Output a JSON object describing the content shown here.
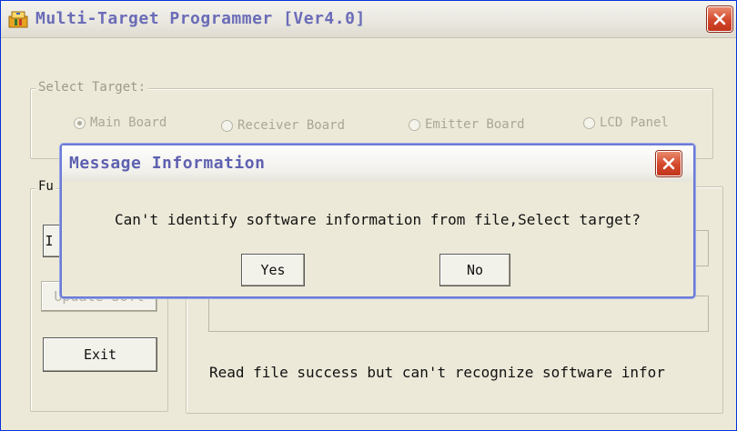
{
  "window": {
    "title": "Multi-Target Programmer [Ver4.0]"
  },
  "select_target": {
    "legend": "Select Target:",
    "options": [
      {
        "label": "Main Board",
        "checked": true
      },
      {
        "label": "Receiver Board",
        "checked": false
      },
      {
        "label": "Emitter Board",
        "checked": false
      },
      {
        "label": "LCD Panel",
        "checked": false
      }
    ]
  },
  "function_group": {
    "legend": "Fu",
    "partial_button_label": "I",
    "update_button_label": "Update Soft",
    "exit_label": "Exit"
  },
  "status": {
    "message": "Read file success but can't recognize software infor"
  },
  "dialog": {
    "title": "Message Information",
    "message": "Can't identify software information from file,Select target?",
    "yes_label": "Yes",
    "no_label": "No"
  },
  "icons": {
    "app": "programmer-app-icon",
    "close": "close-icon"
  },
  "colors": {
    "title_text": "#6b6cb8",
    "close_button": "#d3472b",
    "dialog_border": "#6b7bd6",
    "window_bg": "#ece9d8"
  }
}
